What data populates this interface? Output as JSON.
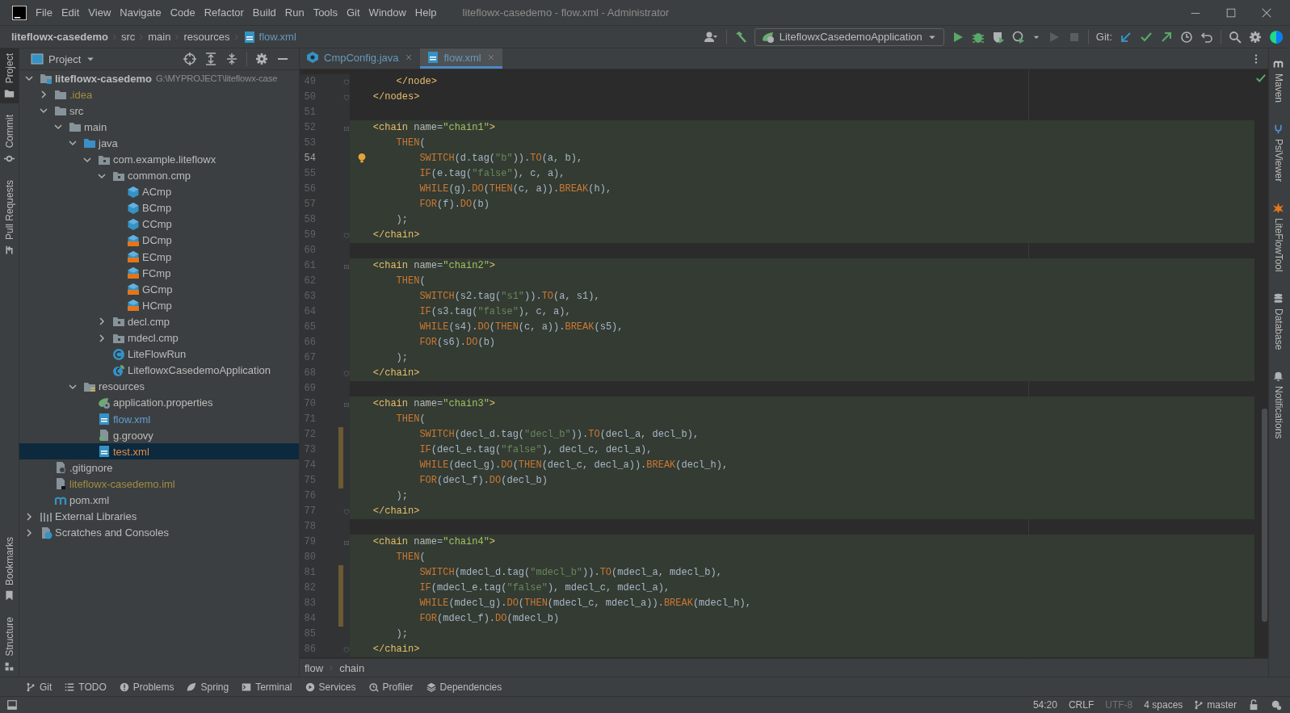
{
  "window": {
    "title": "liteflowx-casedemo - flow.xml - Administrator"
  },
  "menu": [
    "File",
    "Edit",
    "View",
    "Navigate",
    "Code",
    "Refactor",
    "Build",
    "Run",
    "Tools",
    "Git",
    "Window",
    "Help"
  ],
  "navbar": {
    "breadcrumb": [
      {
        "label": "liteflowx-casedemo",
        "kind": "project"
      },
      {
        "label": "src",
        "kind": "folder"
      },
      {
        "label": "main",
        "kind": "folder"
      },
      {
        "label": "resources",
        "kind": "folder"
      },
      {
        "label": "flow.xml",
        "kind": "xml"
      }
    ],
    "run_config": "LiteflowxCasedemoApplication",
    "git_label": "Git:"
  },
  "left_strip": {
    "top": [
      {
        "label": "Project",
        "kind": "folder",
        "selected": true
      },
      {
        "label": "Commit",
        "kind": "commit",
        "selected": false
      },
      {
        "label": "Pull Requests",
        "kind": "pull",
        "selected": false
      }
    ],
    "bottom": [
      {
        "label": "Bookmarks",
        "kind": "bookmark",
        "selected": false
      },
      {
        "label": "Structure",
        "kind": "structure",
        "selected": false
      }
    ]
  },
  "project_panel": {
    "title": "Project",
    "tree": [
      {
        "label": "liteflowx-casedemo",
        "note": "G:\\MYPROJECT\\liteflowx-case",
        "kind": "module",
        "expanded": true,
        "selected": false,
        "children": [
          {
            "label": ".idea",
            "kind": "folder",
            "expanded": false,
            "selected": false,
            "color": "#a18c41"
          },
          {
            "label": "src",
            "kind": "folder",
            "expanded": true,
            "selected": false,
            "children": [
              {
                "label": "main",
                "kind": "folder",
                "expanded": true,
                "selected": false,
                "children": [
                  {
                    "label": "java",
                    "kind": "source-folder",
                    "expanded": true,
                    "selected": false,
                    "children": [
                      {
                        "label": "com.example.liteflowx",
                        "kind": "package",
                        "expanded": true,
                        "selected": false,
                        "children": [
                          {
                            "label": "common.cmp",
                            "kind": "package",
                            "expanded": true,
                            "selected": false,
                            "children": [
                              {
                                "label": "ACmp",
                                "kind": "component",
                                "selected": false
                              },
                              {
                                "label": "BCmp",
                                "kind": "component",
                                "selected": false
                              },
                              {
                                "label": "CCmp",
                                "kind": "component",
                                "selected": false
                              },
                              {
                                "label": "DCmp",
                                "kind": "component-flow",
                                "selected": false
                              },
                              {
                                "label": "ECmp",
                                "kind": "component-flow",
                                "selected": false
                              },
                              {
                                "label": "FCmp",
                                "kind": "component-flow",
                                "selected": false
                              },
                              {
                                "label": "GCmp",
                                "kind": "component-flow",
                                "selected": false
                              },
                              {
                                "label": "HCmp",
                                "kind": "component-flow",
                                "selected": false
                              }
                            ]
                          },
                          {
                            "label": "decl.cmp",
                            "kind": "package",
                            "expanded": false,
                            "selected": false
                          },
                          {
                            "label": "mdecl.cmp",
                            "kind": "package",
                            "expanded": false,
                            "selected": false
                          },
                          {
                            "label": "LiteFlowRun",
                            "kind": "class",
                            "selected": false
                          },
                          {
                            "label": "LiteflowxCasedemoApplication",
                            "kind": "spring-class",
                            "selected": false
                          }
                        ]
                      }
                    ]
                  },
                  {
                    "label": "resources",
                    "kind": "resources-folder",
                    "expanded": true,
                    "selected": false,
                    "children": [
                      {
                        "label": "application.properties",
                        "kind": "properties",
                        "selected": false
                      },
                      {
                        "label": "flow.xml",
                        "kind": "xml",
                        "selected": false,
                        "color": "#5f9fd6"
                      },
                      {
                        "label": "g.groovy",
                        "kind": "groovy",
                        "selected": false
                      },
                      {
                        "label": "test.xml",
                        "kind": "xml",
                        "selected": true,
                        "color": "#e08d45"
                      }
                    ]
                  }
                ]
              }
            ]
          },
          {
            "label": ".gitignore",
            "kind": "ignore-file",
            "selected": false
          },
          {
            "label": "liteflowx-casedemo.iml",
            "kind": "module-file",
            "selected": false,
            "color": "#a18c41"
          },
          {
            "label": "pom.xml",
            "kind": "maven",
            "selected": false
          }
        ]
      },
      {
        "label": "External Libraries",
        "kind": "libraries",
        "expanded": false,
        "selected": false
      },
      {
        "label": "Scratches and Consoles",
        "kind": "scratches",
        "expanded": false,
        "selected": false
      }
    ]
  },
  "editor": {
    "tabs": [
      {
        "label": "CmpConfig.java",
        "kind": "java",
        "selected": false
      },
      {
        "label": "flow.xml",
        "kind": "xml",
        "selected": true
      }
    ],
    "lines": [
      {
        "number": "49",
        "highlighted": false,
        "current": false,
        "markers": [
          {
            "kind": "fold-end"
          }
        ],
        "code": [
          {
            "kind": "tag",
            "text": "        </node>"
          }
        ]
      },
      {
        "number": "50",
        "highlighted": false,
        "current": false,
        "markers": [
          {
            "kind": "fold-end"
          }
        ],
        "code": [
          {
            "kind": "tag",
            "text": "    </nodes>"
          }
        ]
      },
      {
        "number": "51",
        "current": false
      },
      {
        "number": "52",
        "highlighted": true,
        "current": false,
        "markers": [
          {
            "kind": "fold-start"
          }
        ],
        "code": [
          {
            "kind": "tag",
            "text": "    <chain"
          },
          {
            "kind": "attr",
            "text": " name"
          },
          {
            "kind": "id",
            "text": "="
          },
          {
            "kind": "xstr",
            "text": "\"chain1\""
          },
          {
            "kind": "tag",
            "text": ">"
          }
        ]
      },
      {
        "number": "53",
        "highlighted": true,
        "current": false,
        "code": [
          {
            "kind": "kw",
            "text": "        THEN"
          },
          {
            "kind": "id",
            "text": "("
          }
        ]
      },
      {
        "number": "54",
        "highlighted": true,
        "current": true,
        "markers": [
          {
            "kind": "bulb"
          }
        ],
        "code": [
          {
            "kind": "kw",
            "text": "            SWITCH"
          },
          {
            "kind": "id",
            "text": "(d.tag("
          },
          {
            "kind": "str",
            "text": "\"b\""
          },
          {
            "kind": "id",
            "text": "))."
          },
          {
            "kind": "kw",
            "text": "TO"
          },
          {
            "kind": "id",
            "text": "(a, b),"
          }
        ]
      },
      {
        "number": "55",
        "highlighted": true,
        "current": false,
        "code": [
          {
            "kind": "kw",
            "text": "            IF"
          },
          {
            "kind": "id",
            "text": "(e.tag("
          },
          {
            "kind": "str",
            "text": "\"false\""
          },
          {
            "kind": "id",
            "text": "), c, a),"
          }
        ]
      },
      {
        "number": "56",
        "highlighted": true,
        "current": false,
        "code": [
          {
            "kind": "kw",
            "text": "            WHILE"
          },
          {
            "kind": "id",
            "text": "(g)."
          },
          {
            "kind": "kw",
            "text": "DO"
          },
          {
            "kind": "id",
            "text": "("
          },
          {
            "kind": "kw",
            "text": "THEN"
          },
          {
            "kind": "id",
            "text": "(c, a))."
          },
          {
            "kind": "kw",
            "text": "BREAK"
          },
          {
            "kind": "id",
            "text": "(h),"
          }
        ]
      },
      {
        "number": "57",
        "highlighted": true,
        "current": false,
        "code": [
          {
            "kind": "kw",
            "text": "            FOR"
          },
          {
            "kind": "id",
            "text": "(f)."
          },
          {
            "kind": "kw",
            "text": "DO"
          },
          {
            "kind": "id",
            "text": "(b)"
          }
        ]
      },
      {
        "number": "58",
        "highlighted": true,
        "current": false,
        "code": [
          {
            "kind": "id",
            "text": "        );"
          }
        ]
      },
      {
        "number": "59",
        "highlighted": true,
        "current": false,
        "markers": [
          {
            "kind": "fold-end"
          }
        ],
        "code": [
          {
            "kind": "tag",
            "text": "    </chain>"
          }
        ]
      },
      {
        "number": "60",
        "current": false
      },
      {
        "number": "61",
        "highlighted": true,
        "current": false,
        "markers": [
          {
            "kind": "fold-start"
          }
        ],
        "code": [
          {
            "kind": "tag",
            "text": "    <chain"
          },
          {
            "kind": "attr",
            "text": " name"
          },
          {
            "kind": "id",
            "text": "="
          },
          {
            "kind": "xstr",
            "text": "\"chain2\""
          },
          {
            "kind": "tag",
            "text": ">"
          }
        ]
      },
      {
        "number": "62",
        "highlighted": true,
        "current": false,
        "code": [
          {
            "kind": "kw",
            "text": "        THEN"
          },
          {
            "kind": "id",
            "text": "("
          }
        ]
      },
      {
        "number": "63",
        "highlighted": true,
        "current": false,
        "code": [
          {
            "kind": "kw",
            "text": "            SWITCH"
          },
          {
            "kind": "id",
            "text": "(s2.tag("
          },
          {
            "kind": "str",
            "text": "\"s1\""
          },
          {
            "kind": "id",
            "text": "))."
          },
          {
            "kind": "kw",
            "text": "TO"
          },
          {
            "kind": "id",
            "text": "(a, s1),"
          }
        ]
      },
      {
        "number": "64",
        "highlighted": true,
        "current": false,
        "code": [
          {
            "kind": "kw",
            "text": "            IF"
          },
          {
            "kind": "id",
            "text": "(s3.tag("
          },
          {
            "kind": "str",
            "text": "\"false\""
          },
          {
            "kind": "id",
            "text": "), c, a),"
          }
        ]
      },
      {
        "number": "65",
        "highlighted": true,
        "current": false,
        "code": [
          {
            "kind": "kw",
            "text": "            WHILE"
          },
          {
            "kind": "id",
            "text": "(s4)."
          },
          {
            "kind": "kw",
            "text": "DO"
          },
          {
            "kind": "id",
            "text": "("
          },
          {
            "kind": "kw",
            "text": "THEN"
          },
          {
            "kind": "id",
            "text": "(c, a))."
          },
          {
            "kind": "kw",
            "text": "BREAK"
          },
          {
            "kind": "id",
            "text": "(s5),"
          }
        ]
      },
      {
        "number": "66",
        "highlighted": true,
        "current": false,
        "code": [
          {
            "kind": "kw",
            "text": "            FOR"
          },
          {
            "kind": "id",
            "text": "(s6)."
          },
          {
            "kind": "kw",
            "text": "DO"
          },
          {
            "kind": "id",
            "text": "(b)"
          }
        ]
      },
      {
        "number": "67",
        "highlighted": true,
        "current": false,
        "code": [
          {
            "kind": "id",
            "text": "        );"
          }
        ]
      },
      {
        "number": "68",
        "highlighted": true,
        "current": false,
        "markers": [
          {
            "kind": "fold-end"
          }
        ],
        "code": [
          {
            "kind": "tag",
            "text": "    </chain>"
          }
        ]
      },
      {
        "number": "69",
        "current": false
      },
      {
        "number": "70",
        "highlighted": true,
        "current": false,
        "markers": [
          {
            "kind": "fold-start"
          }
        ],
        "code": [
          {
            "kind": "tag",
            "text": "    <chain"
          },
          {
            "kind": "attr",
            "text": " name"
          },
          {
            "kind": "id",
            "text": "="
          },
          {
            "kind": "xstr",
            "text": "\"chain3\""
          },
          {
            "kind": "tag",
            "text": ">"
          }
        ]
      },
      {
        "number": "71",
        "highlighted": true,
        "current": false,
        "code": [
          {
            "kind": "kw",
            "text": "        THEN"
          },
          {
            "kind": "id",
            "text": "("
          }
        ]
      },
      {
        "number": "72",
        "highlighted": true,
        "current": false,
        "markers": [
          {
            "kind": "change"
          }
        ],
        "code": [
          {
            "kind": "kw",
            "text": "            SWITCH"
          },
          {
            "kind": "id",
            "text": "(decl_d.tag("
          },
          {
            "kind": "str",
            "text": "\"decl_b\""
          },
          {
            "kind": "id",
            "text": "))."
          },
          {
            "kind": "kw",
            "text": "TO"
          },
          {
            "kind": "id",
            "text": "(decl_a, decl_b),"
          }
        ]
      },
      {
        "number": "73",
        "highlighted": true,
        "current": false,
        "markers": [
          {
            "kind": "change"
          }
        ],
        "code": [
          {
            "kind": "kw",
            "text": "            IF"
          },
          {
            "kind": "id",
            "text": "(decl_e.tag("
          },
          {
            "kind": "str",
            "text": "\"false\""
          },
          {
            "kind": "id",
            "text": "), decl_c, decl_a),"
          }
        ]
      },
      {
        "number": "74",
        "highlighted": true,
        "current": false,
        "markers": [
          {
            "kind": "change"
          }
        ],
        "code": [
          {
            "kind": "kw",
            "text": "            WHILE"
          },
          {
            "kind": "id",
            "text": "(decl_g)."
          },
          {
            "kind": "kw",
            "text": "DO"
          },
          {
            "kind": "id",
            "text": "("
          },
          {
            "kind": "kw",
            "text": "THEN"
          },
          {
            "kind": "id",
            "text": "(decl_c, decl_a))."
          },
          {
            "kind": "kw",
            "text": "BREAK"
          },
          {
            "kind": "id",
            "text": "(decl_h),"
          }
        ]
      },
      {
        "number": "75",
        "highlighted": true,
        "current": false,
        "markers": [
          {
            "kind": "change"
          }
        ],
        "code": [
          {
            "kind": "kw",
            "text": "            FOR"
          },
          {
            "kind": "id",
            "text": "(decl_f)."
          },
          {
            "kind": "kw",
            "text": "DO"
          },
          {
            "kind": "id",
            "text": "(decl_b)"
          }
        ]
      },
      {
        "number": "76",
        "highlighted": true,
        "current": false,
        "code": [
          {
            "kind": "id",
            "text": "        );"
          }
        ]
      },
      {
        "number": "77",
        "highlighted": true,
        "current": false,
        "markers": [
          {
            "kind": "fold-end"
          }
        ],
        "code": [
          {
            "kind": "tag",
            "text": "    </chain>"
          }
        ]
      },
      {
        "number": "78",
        "current": false
      },
      {
        "number": "79",
        "highlighted": true,
        "current": false,
        "markers": [
          {
            "kind": "fold-start"
          }
        ],
        "code": [
          {
            "kind": "tag",
            "text": "    <chain"
          },
          {
            "kind": "attr",
            "text": " name"
          },
          {
            "kind": "id",
            "text": "="
          },
          {
            "kind": "xstr",
            "text": "\"chain4\""
          },
          {
            "kind": "tag",
            "text": ">"
          }
        ]
      },
      {
        "number": "80",
        "highlighted": true,
        "current": false,
        "code": [
          {
            "kind": "kw",
            "text": "        THEN"
          },
          {
            "kind": "id",
            "text": "("
          }
        ]
      },
      {
        "number": "81",
        "highlighted": true,
        "current": false,
        "markers": [
          {
            "kind": "change"
          }
        ],
        "code": [
          {
            "kind": "kw",
            "text": "            SWITCH"
          },
          {
            "kind": "id",
            "text": "(mdecl_d.tag("
          },
          {
            "kind": "str",
            "text": "\"mdecl_b\""
          },
          {
            "kind": "id",
            "text": "))."
          },
          {
            "kind": "kw",
            "text": "TO"
          },
          {
            "kind": "id",
            "text": "(mdecl_a, mdecl_b),"
          }
        ]
      },
      {
        "number": "82",
        "highlighted": true,
        "current": false,
        "markers": [
          {
            "kind": "change"
          }
        ],
        "code": [
          {
            "kind": "kw",
            "text": "            IF"
          },
          {
            "kind": "id",
            "text": "(mdecl_e.tag("
          },
          {
            "kind": "str",
            "text": "\"false\""
          },
          {
            "kind": "id",
            "text": "), mdecl_c, mdecl_a),"
          }
        ]
      },
      {
        "number": "83",
        "highlighted": true,
        "current": false,
        "markers": [
          {
            "kind": "change"
          }
        ],
        "code": [
          {
            "kind": "kw",
            "text": "            WHILE"
          },
          {
            "kind": "id",
            "text": "(mdecl_g)."
          },
          {
            "kind": "kw",
            "text": "DO"
          },
          {
            "kind": "id",
            "text": "("
          },
          {
            "kind": "kw",
            "text": "THEN"
          },
          {
            "kind": "id",
            "text": "(mdecl_c, mdecl_a))."
          },
          {
            "kind": "kw",
            "text": "BREAK"
          },
          {
            "kind": "id",
            "text": "(mdecl_h),"
          }
        ]
      },
      {
        "number": "84",
        "highlighted": true,
        "current": false,
        "markers": [
          {
            "kind": "change"
          }
        ],
        "code": [
          {
            "kind": "kw",
            "text": "            FOR"
          },
          {
            "kind": "id",
            "text": "(mdecl_f)."
          },
          {
            "kind": "kw",
            "text": "DO"
          },
          {
            "kind": "id",
            "text": "(mdecl_b)"
          }
        ]
      },
      {
        "number": "85",
        "highlighted": true,
        "current": false,
        "code": [
          {
            "kind": "id",
            "text": "        );"
          }
        ]
      },
      {
        "number": "86",
        "highlighted": true,
        "current": false,
        "markers": [
          {
            "kind": "fold-end"
          }
        ],
        "code": [
          {
            "kind": "tag",
            "text": "    </chain>"
          }
        ]
      }
    ],
    "breadcrumb": [
      "flow",
      "chain"
    ]
  },
  "right_strip": [
    {
      "label": "Maven",
      "kind": "maven"
    },
    {
      "label": "PsiViewer",
      "kind": "psi"
    },
    {
      "label": "LiteFlowTool",
      "kind": "liteflow"
    },
    {
      "label": "Database",
      "kind": "database"
    },
    {
      "label": "Notifications",
      "kind": "bell"
    }
  ],
  "tool_tabs": [
    {
      "label": "Git",
      "kind": "branch"
    },
    {
      "label": "TODO",
      "kind": "list"
    },
    {
      "label": "Problems",
      "kind": "problems"
    },
    {
      "label": "Spring",
      "kind": "leaf"
    },
    {
      "label": "Terminal",
      "kind": "terminal"
    },
    {
      "label": "Services",
      "kind": "services"
    },
    {
      "label": "Profiler",
      "kind": "profiler"
    },
    {
      "label": "Dependencies",
      "kind": "layers"
    }
  ],
  "status_bar": [
    {
      "text": "54:20",
      "kind": "text",
      "disabled": false
    },
    {
      "text": "CRLF",
      "kind": "text",
      "disabled": false
    },
    {
      "text": "UTF-8",
      "kind": "text",
      "disabled": true
    },
    {
      "text": "4 spaces",
      "kind": "text",
      "disabled": false
    },
    {
      "text": "master",
      "kind": "branch",
      "disabled": false
    }
  ]
}
